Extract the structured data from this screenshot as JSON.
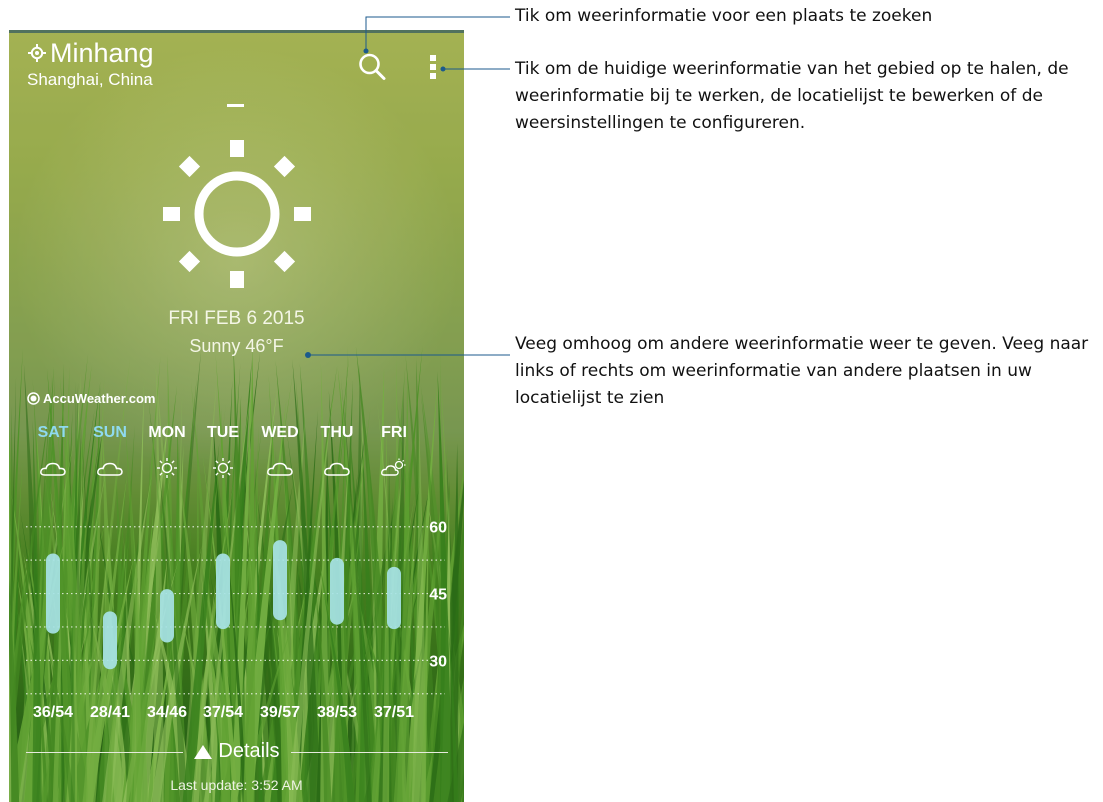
{
  "location": {
    "city": "Minhang",
    "region": "Shanghai, China"
  },
  "icons": {
    "location": "location-icon",
    "search": "search-icon",
    "menu": "menu-icon",
    "weather": "sun-icon"
  },
  "current": {
    "date": "FRI FEB 6 2015",
    "condition": "Sunny 46°F"
  },
  "provider": "AccuWeather.com",
  "forecast": {
    "days": [
      {
        "day": "SAT",
        "icon": "cloud-icon",
        "range": "36/54",
        "highlight": true
      },
      {
        "day": "SUN",
        "icon": "cloud-icon",
        "range": "28/41",
        "highlight": true
      },
      {
        "day": "MON",
        "icon": "sun-icon",
        "range": "34/46",
        "highlight": false
      },
      {
        "day": "TUE",
        "icon": "sun-icon",
        "range": "37/54",
        "highlight": false
      },
      {
        "day": "WED",
        "icon": "cloud-icon",
        "range": "39/57",
        "highlight": false
      },
      {
        "day": "THU",
        "icon": "cloud-icon",
        "range": "38/53",
        "highlight": false
      },
      {
        "day": "FRI",
        "icon": "partly-cloudy-icon",
        "range": "37/51",
        "highlight": false
      }
    ]
  },
  "chart_data": {
    "type": "bar",
    "categories": [
      "SAT",
      "SUN",
      "MON",
      "TUE",
      "WED",
      "THU",
      "FRI"
    ],
    "series": [
      {
        "low": [
          36,
          28,
          34,
          37,
          39,
          38,
          37
        ],
        "high": [
          54,
          41,
          46,
          54,
          57,
          53,
          51
        ]
      }
    ],
    "y_ticks": [
      30,
      45,
      60
    ],
    "ylim": [
      22,
      66
    ],
    "grid": true,
    "bar_color": "#a7e3e6"
  },
  "details_label": "Details",
  "last_update": "Last update: 3:52 AM",
  "callouts": [
    {
      "text": "Tik om weerinformatie voor een plaats te zoeken"
    },
    {
      "text": "Tik om de huidige weerinformatie van het gebied op te halen, de weerinformatie bij te werken, de locatielijst te bewerken of de weersinstellingen te configureren."
    },
    {
      "text": "Veeg omhoog om andere weerinformatie weer te geven. Veeg naar links of rechts om weerinformatie van andere plaatsen in uw locatielijst te zien"
    }
  ],
  "colors": {
    "highlight_day": "#8fdaf0",
    "leader_line": "#1b5a8c"
  }
}
